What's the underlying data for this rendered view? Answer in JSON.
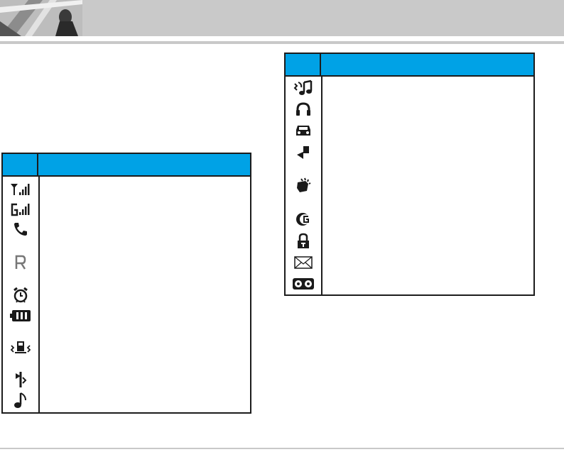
{
  "colors": {
    "header_band": "#c9c9c9",
    "table_header": "#00a2e6",
    "border": "#1c1c1c"
  },
  "table_left": {
    "icons": [
      "signal-strength-icon",
      "gprs-signal-icon",
      "call-active-icon",
      "roaming-icon",
      "alarm-icon",
      "battery-icon",
      "vibrate-icon",
      "silent-icon",
      "ring-icon"
    ]
  },
  "table_right": {
    "icons": [
      "ring-and-vibrate-icon",
      "headset-icon",
      "car-kit-icon",
      "call-forward-icon",
      "speakerphone-icon",
      "gprs-attached-icon",
      "lock-icon",
      "message-icon",
      "voicemail-icon"
    ]
  }
}
